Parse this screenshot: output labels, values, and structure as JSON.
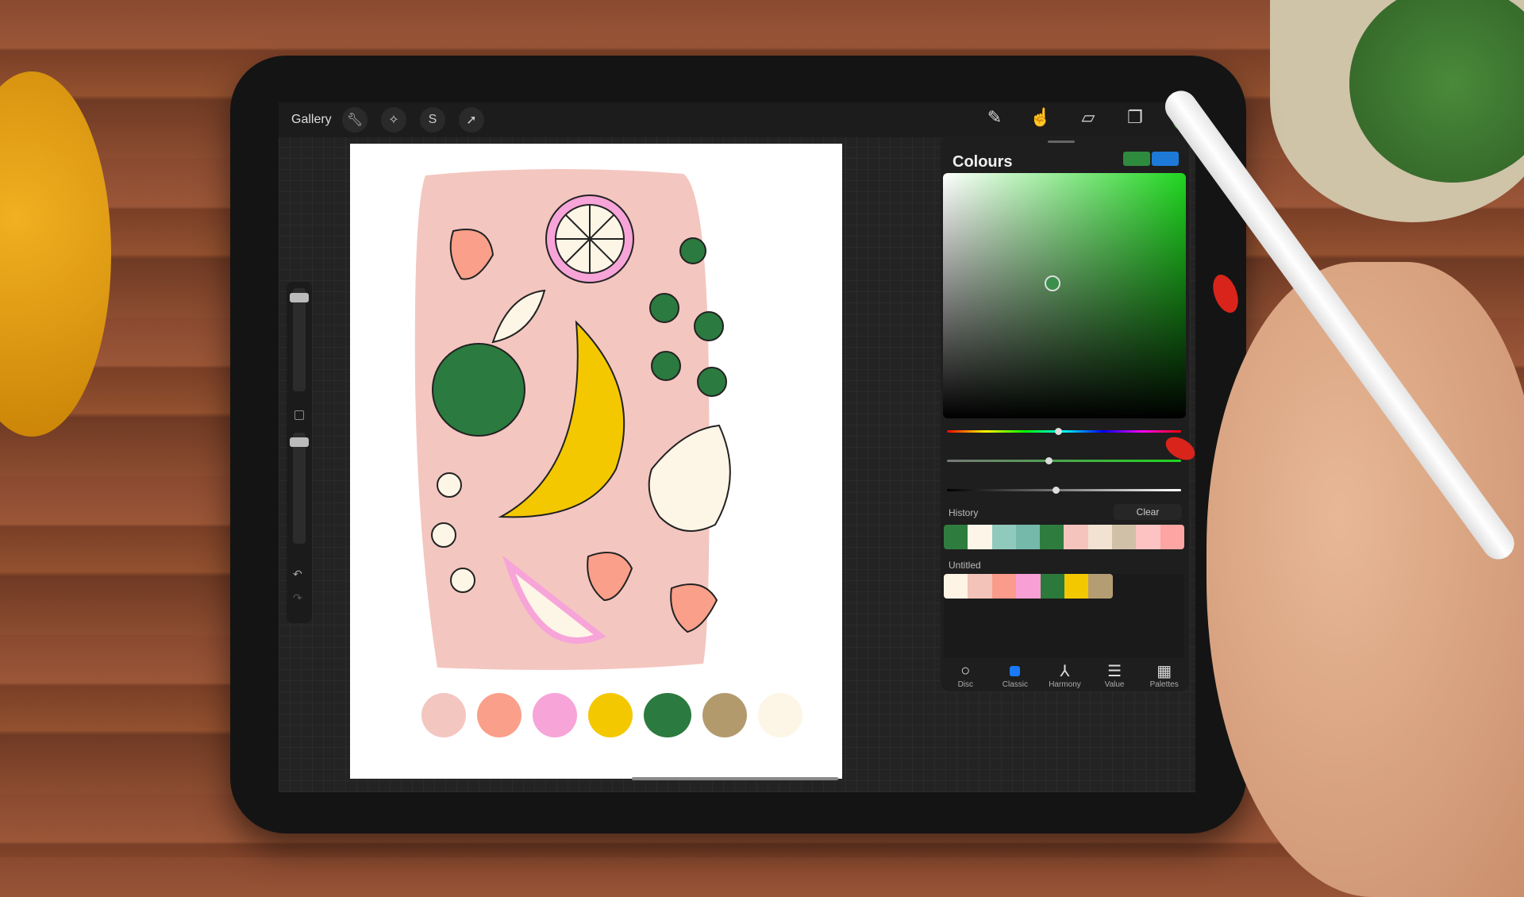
{
  "toolbar": {
    "gallery_label": "Gallery",
    "left_icons": [
      "wrench-icon",
      "magic-wand-icon",
      "selection-icon",
      "transform-arrow-icon"
    ],
    "right_icons": [
      "brush-icon",
      "smudge-icon",
      "eraser-icon",
      "layers-icon"
    ],
    "current_color": "#2e8b3e"
  },
  "colours_panel": {
    "title": "Colours",
    "primary_color": "#2e8b3e",
    "secondary_color": "#1e7ad8",
    "hue_fraction": 0.46,
    "saturation_fraction": 0.42,
    "brightness_fraction": 0.45,
    "history_label": "History",
    "clear_label": "Clear",
    "history": [
      "#2e7d3e",
      "#fdf6e8",
      "#8fcabd",
      "#74b9a9",
      "#2e7d3e",
      "#f4c4bd",
      "#f1e2d2",
      "#d1c0a8",
      "#fdc2c2",
      "#fca5a2"
    ],
    "palette_label": "Untitled",
    "palette": [
      "#fdf4e6",
      "#f3c2b9",
      "#fb9b8b",
      "#f89fd6",
      "#2c7a3b",
      "#f4c800",
      "#b49d72"
    ],
    "tabs": [
      {
        "label": "Disc",
        "icon": "disc-icon"
      },
      {
        "label": "Classic",
        "icon": "classic-square-icon",
        "active": true
      },
      {
        "label": "Harmony",
        "icon": "harmony-icon"
      },
      {
        "label": "Value",
        "icon": "value-sliders-icon"
      },
      {
        "label": "Palettes",
        "icon": "palettes-grid-icon"
      }
    ]
  },
  "artwork": {
    "background": "#f4c6c0",
    "swatches": [
      "#f4c6c0",
      "#fa9f8a",
      "#f7a4d8",
      "#f4c800",
      "#2b7a3f",
      "#b39a6d",
      "#fdf6e6"
    ]
  }
}
